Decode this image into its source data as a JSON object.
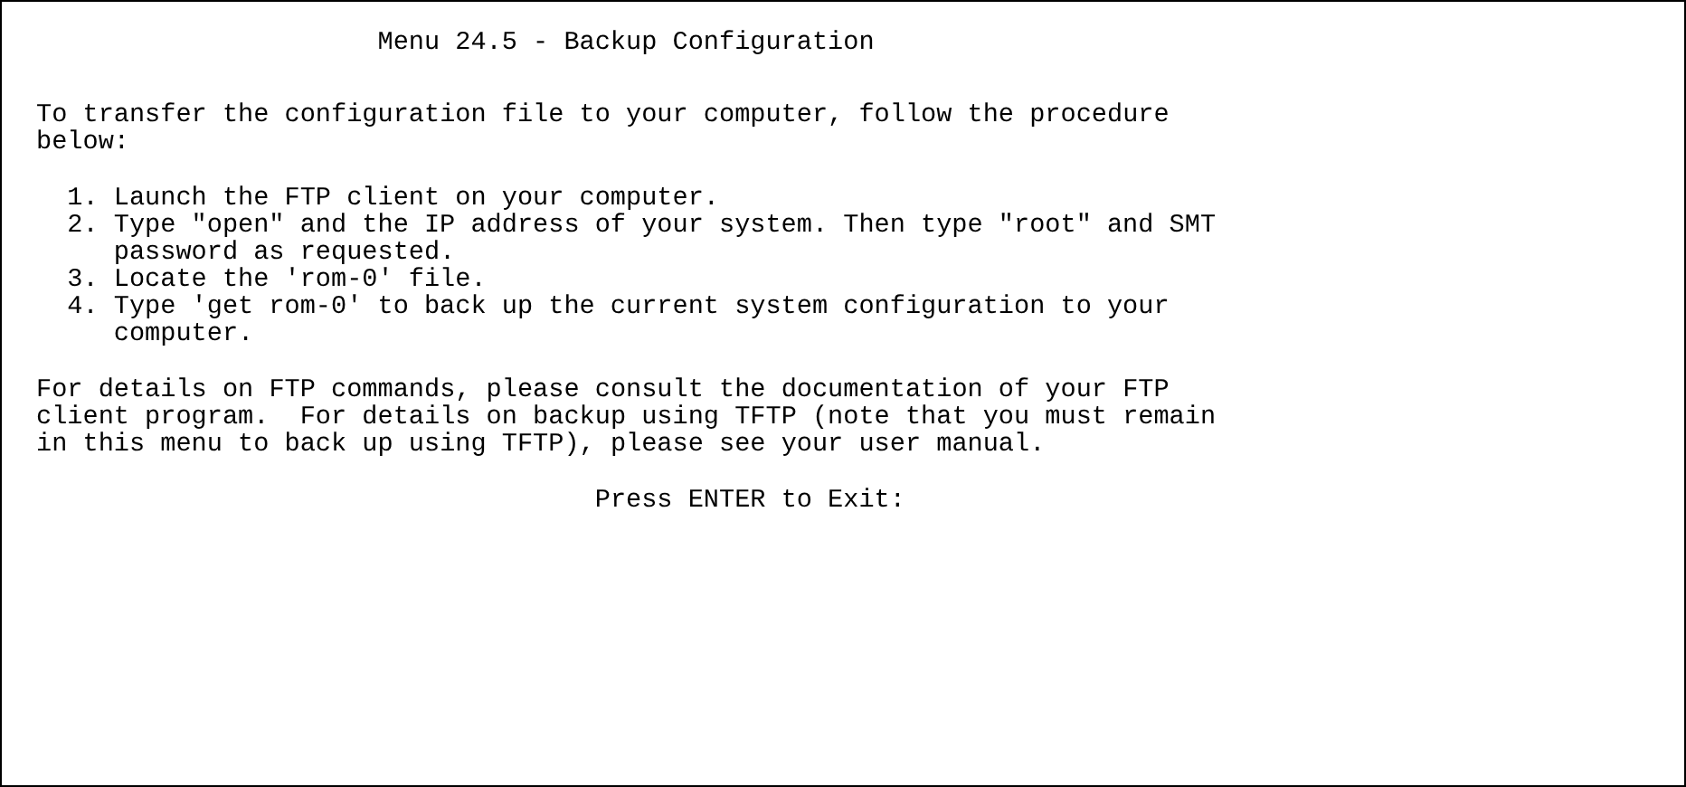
{
  "title": "Menu 24.5 - Backup Configuration",
  "intro": "To transfer the configuration file to your computer, follow the procedure below:",
  "steps": [
    {
      "number": "1.",
      "text": "Launch the FTP client on your computer."
    },
    {
      "number": "2.",
      "text": "Type \"open\" and the IP address of your system. Then type \"root\" and SMT password as requested."
    },
    {
      "number": "3.",
      "text": "Locate the 'rom-0' file."
    },
    {
      "number": "4.",
      "text": "Type 'get rom-0' to back up the current system configuration to your computer."
    }
  ],
  "note": "For details on FTP commands, please consult the documentation of your FTP client program.  For details on backup using TFTP (note that you must remain in this menu to back up using TFTP), please see your user manual.",
  "prompt": "Press ENTER to Exit:"
}
